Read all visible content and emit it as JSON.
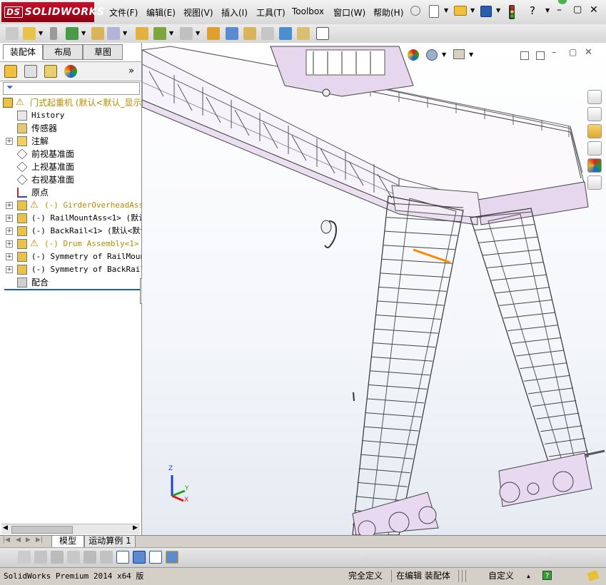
{
  "app": {
    "logo_text": "SOLIDWORKS",
    "logo_prefix": "DS",
    "accent_color": "#c8102e"
  },
  "menu": {
    "items": [
      "文件(F)",
      "编辑(E)",
      "视图(V)",
      "插入(I)",
      "工具(T)",
      "Toolbox",
      "窗口(W)",
      "帮助(H)"
    ]
  },
  "window_controls": {
    "minimize": "–",
    "restore": "▢",
    "close": "✕"
  },
  "panel_tabs": [
    "装配体",
    "布局",
    "草图"
  ],
  "feature_tree": {
    "root": "门式起重机  (默认<默认_显示",
    "items": [
      {
        "label": "History",
        "mono": true,
        "warn": false,
        "expandable": false,
        "icon": "history-icon"
      },
      {
        "label": "传感器",
        "mono": false,
        "warn": false,
        "expandable": false,
        "icon": "sensor-icon"
      },
      {
        "label": "注解",
        "mono": false,
        "warn": false,
        "expandable": true,
        "icon": "annotation-icon"
      },
      {
        "label": "前视基准面",
        "mono": false,
        "warn": false,
        "expandable": false,
        "icon": "plane-icon"
      },
      {
        "label": "上视基准面",
        "mono": false,
        "warn": false,
        "expandable": false,
        "icon": "plane-icon"
      },
      {
        "label": "右视基准面",
        "mono": false,
        "warn": false,
        "expandable": false,
        "icon": "plane-icon"
      },
      {
        "label": "原点",
        "mono": false,
        "warn": false,
        "expandable": false,
        "icon": "origin-icon"
      },
      {
        "label": "(-) GirderOverheadAssem",
        "mono": true,
        "warn": true,
        "expandable": true,
        "icon": "assembly-icon"
      },
      {
        "label": "(-) RailMountAss<1> (默认<",
        "mono": true,
        "warn": false,
        "expandable": true,
        "icon": "assembly-icon"
      },
      {
        "label": "(-) BackRail<1> (默认<默认",
        "mono": true,
        "warn": false,
        "expandable": true,
        "icon": "assembly-icon"
      },
      {
        "label": "(-) Drum Assembly<1> (",
        "mono": true,
        "warn": true,
        "expandable": true,
        "icon": "assembly-icon"
      },
      {
        "label": "(-) Symmetry of RailMount",
        "mono": true,
        "warn": false,
        "expandable": true,
        "icon": "assembly-icon"
      },
      {
        "label": "(-) Symmetry of BackRail<",
        "mono": true,
        "warn": false,
        "expandable": true,
        "icon": "assembly-icon"
      },
      {
        "label": "配合",
        "mono": false,
        "warn": false,
        "expandable": false,
        "icon": "mates-icon"
      }
    ]
  },
  "bottom_tabs": [
    "模型",
    "运动算例 1"
  ],
  "status": {
    "product": "SolidWorks Premium 2014 x64 版",
    "definition": "完全定义",
    "editing": "在编辑 装配体",
    "units": "自定义",
    "units_arrow": "▲"
  },
  "triad": {
    "z": "Z",
    "y": "Y",
    "x": "X"
  }
}
